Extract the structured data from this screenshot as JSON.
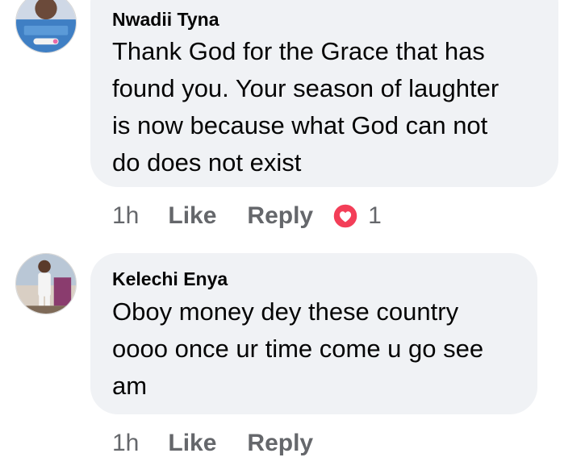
{
  "comments": [
    {
      "author": "Nwadii Tyna",
      "lines": [
        "Thank God for the Grace that has",
        "found you. Your season of laughter",
        "is now because what God can not",
        "do does not exist"
      ],
      "time": "1h",
      "like_label": "Like",
      "reply_label": "Reply",
      "reaction": {
        "icon": "love-heart-icon",
        "count": "1",
        "color": "#f33e58"
      },
      "avatar_icon": "profile-avatar"
    },
    {
      "author": "Kelechi Enya",
      "lines": [
        "Oboy money dey these country",
        "oooo once ur time come u go see",
        "am"
      ],
      "time": "1h",
      "like_label": "Like",
      "reply_label": "Reply",
      "avatar_icon": "profile-avatar"
    }
  ],
  "colors": {
    "bubble_bg": "#f0f2f5",
    "meta_text": "#65676b",
    "text": "#050505"
  }
}
